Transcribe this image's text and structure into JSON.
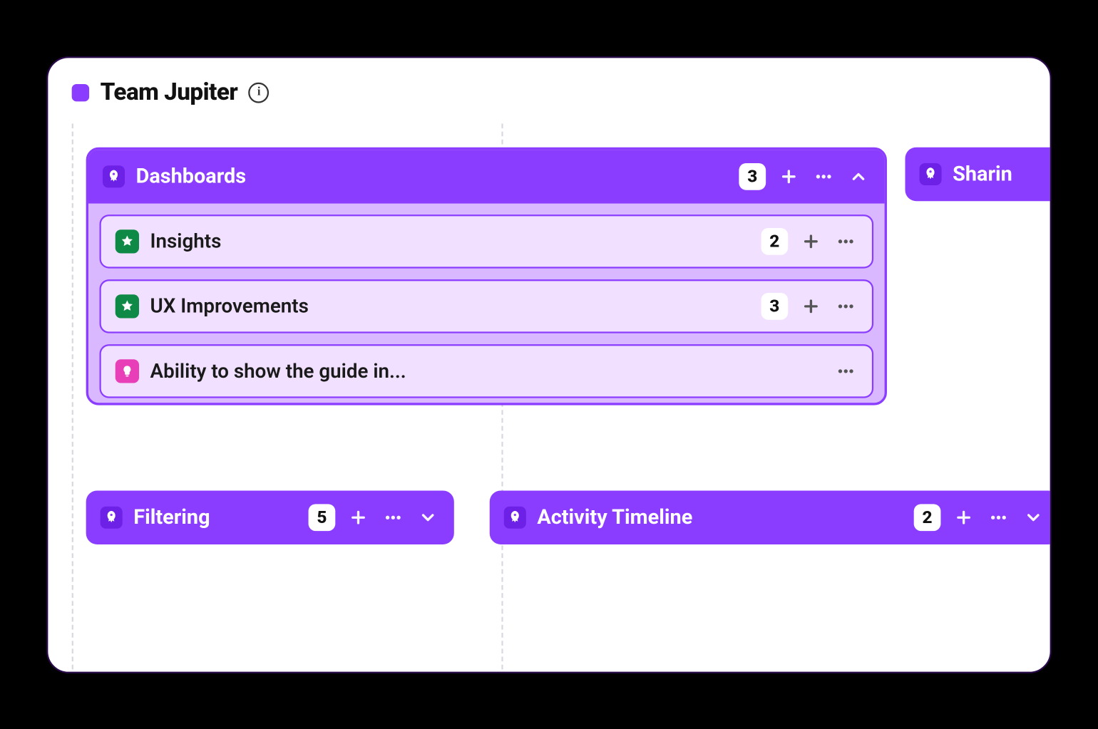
{
  "header": {
    "team_name": "Team Jupiter",
    "team_color": "#8b3dff"
  },
  "epics": {
    "dashboards": {
      "title": "Dashboards",
      "count": "3",
      "items": [
        {
          "type": "feature",
          "label": "Insights",
          "count": "2"
        },
        {
          "type": "feature",
          "label": "UX Improvements",
          "count": "3"
        },
        {
          "type": "idea",
          "label": "Ability to show the guide in..."
        }
      ]
    },
    "sharing": {
      "title": "Sharin"
    },
    "filtering": {
      "title": "Filtering",
      "count": "5"
    },
    "activity": {
      "title": "Activity Timeline",
      "count": "2"
    }
  }
}
